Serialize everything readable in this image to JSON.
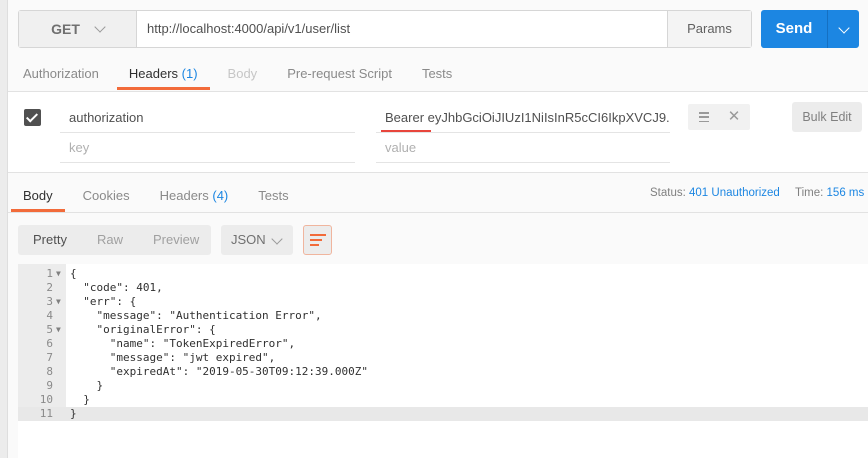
{
  "request": {
    "method": "GET",
    "url": "http://localhost:4000/api/v1/user/list",
    "params_label": "Params",
    "send_label": "Send"
  },
  "request_tabs": [
    {
      "label": "Authorization",
      "count": ""
    },
    {
      "label": "Headers",
      "count": "(1)"
    },
    {
      "label": "Body",
      "count": ""
    },
    {
      "label": "Pre-request Script",
      "count": ""
    },
    {
      "label": "Tests",
      "count": ""
    }
  ],
  "headers_table": {
    "rows": [
      {
        "key": "authorization",
        "value": "Bearer eyJhbGciOiJIUzI1NiIsInR5cCI6IkpXVCJ9.",
        "checked": true
      }
    ],
    "key_placeholder": "key",
    "value_placeholder": "value",
    "bulk_edit_label": "Bulk Edit"
  },
  "response_tabs": [
    {
      "label": "Body",
      "count": ""
    },
    {
      "label": "Cookies",
      "count": ""
    },
    {
      "label": "Headers",
      "count": "(4)"
    },
    {
      "label": "Tests",
      "count": ""
    }
  ],
  "status": {
    "label": "Status:",
    "value": "401 Unauthorized"
  },
  "time": {
    "label": "Time:",
    "value": "156 ms"
  },
  "view_modes": [
    "Pretty",
    "Raw",
    "Preview"
  ],
  "format": "JSON",
  "code_lines": [
    "{",
    "  \"code\": 401,",
    "  \"err\": {",
    "    \"message\": \"Authentication Error\",",
    "    \"originalError\": {",
    "      \"name\": \"TokenExpiredError\",",
    "      \"message\": \"jwt expired\",",
    "      \"expiredAt\": \"2019-05-30T09:12:39.000Z\"",
    "    }",
    "  }",
    "}"
  ],
  "icons": {
    "method_dropdown": "chevron-down-icon",
    "send_dropdown": "chevron-down-icon",
    "row_menu": "hamburger-icon",
    "row_delete": "close-icon",
    "wrap": "wrap-lines-icon"
  },
  "colors": {
    "accent": "#f26b3a",
    "send": "#1c86e2",
    "link": "#1c86e2"
  }
}
